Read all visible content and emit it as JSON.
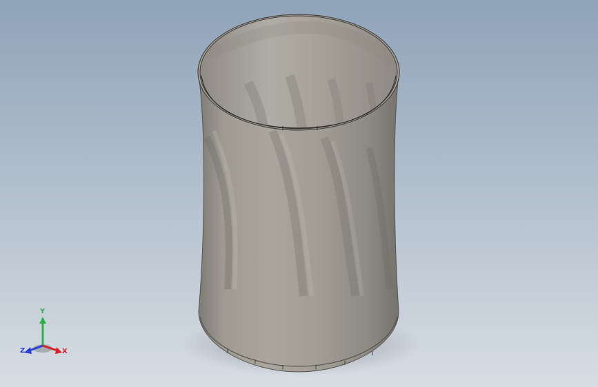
{
  "viewport": {
    "background_top": "#8fa3b9",
    "background_bottom": "#d7dde3"
  },
  "model": {
    "body_color": "#a39f97",
    "body_shadow": "#7d7a74",
    "rim_color": "#5a5852"
  },
  "triad": {
    "x_label": "X",
    "y_label": "Y",
    "z_label": "Z",
    "x_color": "#d8232a",
    "y_color": "#2bb34a",
    "z_color": "#2a3fd6"
  }
}
